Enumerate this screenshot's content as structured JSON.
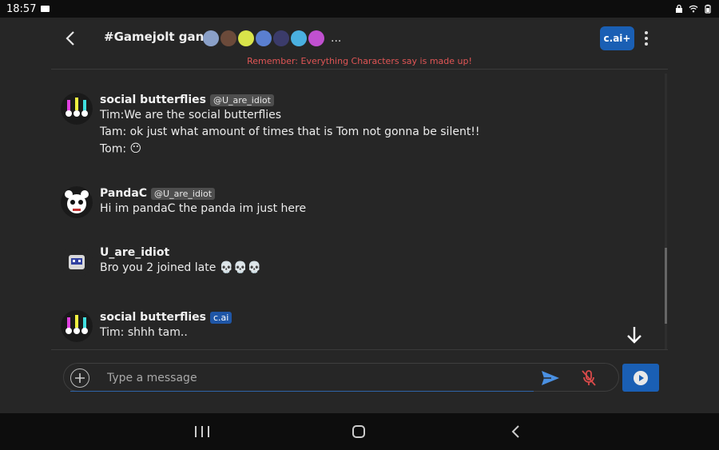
{
  "status_bar": {
    "time": "18:57"
  },
  "header": {
    "title": "#Gamejolt gang",
    "more_members": "...",
    "member_avatars": [
      {
        "name": "member-1",
        "color": "#8aa0c8"
      },
      {
        "name": "member-2",
        "color": "#6b4a3a"
      },
      {
        "name": "member-3",
        "color": "#d8e44a"
      },
      {
        "name": "member-4",
        "color": "#5a7fd0"
      },
      {
        "name": "member-5",
        "color": "#3b3b6a"
      },
      {
        "name": "member-6",
        "color": "#4ab0e0"
      },
      {
        "name": "member-7",
        "color": "#c050d0"
      }
    ],
    "premium_label": "c.ai+",
    "disclaimer": "Remember: Everything Characters say is made up!"
  },
  "messages": [
    {
      "author": "social butterflies",
      "tag": "@U_are_idiot",
      "tag_type": "creator",
      "avatar_icon": "social-butterflies-avatar",
      "lines": [
        "Tim:We are the social butterflies",
        "Tam: ok just what amount of times that is Tom not gonna be silent!!",
        "Tom: "
      ],
      "emoji": "😶"
    },
    {
      "author": "PandaC",
      "tag": "@U_are_idiot",
      "tag_type": "creator",
      "avatar_icon": "panda-avatar",
      "lines": [
        "Hi im pandaC the panda im just here"
      ]
    },
    {
      "author": "U_are_idiot",
      "tag": "",
      "avatar_icon": "robot-avatar",
      "lines": [
        "Bro you 2 joined late 💀💀💀"
      ]
    },
    {
      "author": "social butterflies",
      "tag": "c.ai",
      "tag_type": "ai",
      "avatar_icon": "social-butterflies-avatar",
      "lines": [
        "Tim: shhh tam.."
      ]
    }
  ],
  "composer": {
    "placeholder": "Type a message"
  },
  "colors": {
    "accent": "#1a5fb4",
    "background": "#262626",
    "disclaimer": "#e05555",
    "mic_muted": "#d94a4a"
  }
}
